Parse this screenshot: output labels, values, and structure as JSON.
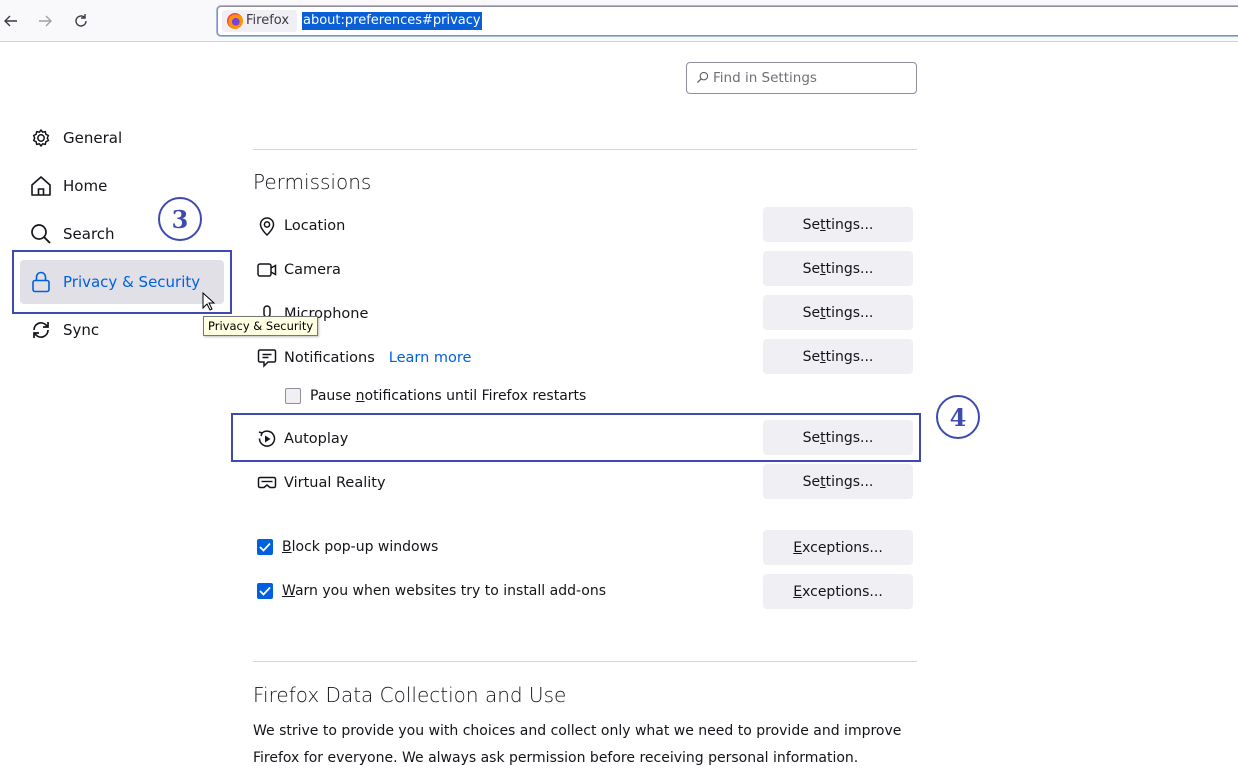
{
  "browser": {
    "back_icon": "arrow-left-icon",
    "forward_icon": "arrow-right-icon",
    "reload_icon": "reload-icon",
    "identity_label": "Firefox",
    "url": "about:preferences#privacy"
  },
  "search": {
    "placeholder": "Find in Settings",
    "value": ""
  },
  "sidebar": {
    "items": [
      {
        "label": "General",
        "icon": "gear-icon",
        "selected": false
      },
      {
        "label": "Home",
        "icon": "home-icon",
        "selected": false
      },
      {
        "label": "Search",
        "icon": "search-icon",
        "selected": false
      },
      {
        "label": "Privacy & Security",
        "icon": "lock-icon",
        "selected": true
      },
      {
        "label": "Sync",
        "icon": "sync-icon",
        "selected": false
      }
    ]
  },
  "tooltip": {
    "text": "Privacy & Security"
  },
  "annotations": {
    "step3": "3",
    "step4": "4",
    "color": "#3d4bb0"
  },
  "permissions": {
    "title": "Permissions",
    "rows": [
      {
        "label": "Location",
        "icon": "location-pin-icon",
        "button": "Settings..."
      },
      {
        "label": "Camera",
        "icon": "camera-icon",
        "button": "Settings..."
      },
      {
        "label": "Microphone",
        "icon": "microphone-icon",
        "button": "Settings..."
      },
      {
        "label": "Notifications",
        "icon": "notification-icon",
        "button": "Settings...",
        "link": "Learn more"
      },
      {
        "label": "Autoplay",
        "icon": "autoplay-icon",
        "button": "Settings..."
      },
      {
        "label": "Virtual Reality",
        "icon": "vr-headset-icon",
        "button": "Settings..."
      }
    ],
    "pause_notifications": {
      "label_pre": "Pause ",
      "label_key": "n",
      "label_post": "otifications until Firefox restarts",
      "checked": false
    },
    "block_popups": {
      "label_key": "B",
      "label_post": "lock pop-up windows",
      "checked": true,
      "button_key": "E",
      "button_post": "xceptions..."
    },
    "warn_addons": {
      "label_key": "W",
      "label_post": "arn you when websites try to install add-ons",
      "checked": true,
      "button_key": "E",
      "button_post": "xceptions..."
    },
    "settings_button": {
      "pre": "Se",
      "key": "t",
      "post": "tings..."
    }
  },
  "data_collection": {
    "title": "Firefox Data Collection and Use",
    "description_line1": "We strive to provide you with choices and collect only what we need to provide and improve",
    "description_line2": "Firefox for everyone. We always ask permission before receiving personal information."
  },
  "colors": {
    "accent": "#0061e0",
    "button_bg": "#f0f0f4",
    "selected_bg": "#e0e0e6"
  }
}
